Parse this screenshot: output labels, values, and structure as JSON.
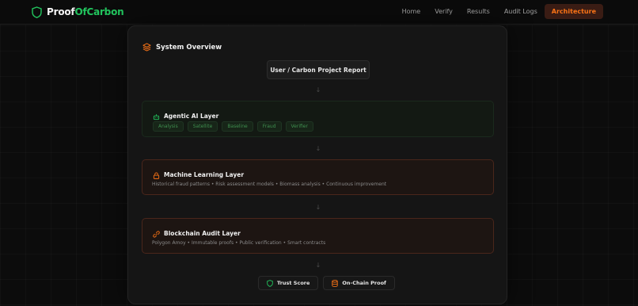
{
  "brand": {
    "part1": "Proof",
    "part2": "OfCarbon",
    "icon": "shield-icon"
  },
  "nav": {
    "links": [
      {
        "label": "Home"
      },
      {
        "label": "Verify"
      },
      {
        "label": "Results"
      },
      {
        "label": "Audit Logs"
      },
      {
        "label": "Architecture",
        "active": true
      }
    ]
  },
  "colors": {
    "accent_green": "#22c55e",
    "accent_orange": "#f97316"
  },
  "overview": {
    "title": "System Overview",
    "title_icon": "layers-icon",
    "input_box": "User / Carbon Project Report",
    "arrow": "↓",
    "layers": [
      {
        "title": "Agentic AI Layer",
        "icon": "bot-icon",
        "chips": [
          "Analysis",
          "Satellite",
          "Baseline",
          "Fraud",
          "Verifier"
        ]
      },
      {
        "title": "Machine Learning Layer",
        "icon": "lock-icon",
        "description": "Historical fraud patterns • Risk assessment models • Biomass analysis • Continuous improvement"
      },
      {
        "title": "Blockchain Audit Layer",
        "icon": "link-icon",
        "description": "Polygon Amoy • Immutable proofs • Public verification • Smart contracts"
      }
    ],
    "outputs": [
      {
        "label": "Trust Score",
        "icon": "shield-icon"
      },
      {
        "label": "On-Chain Proof",
        "icon": "database-icon"
      }
    ]
  }
}
